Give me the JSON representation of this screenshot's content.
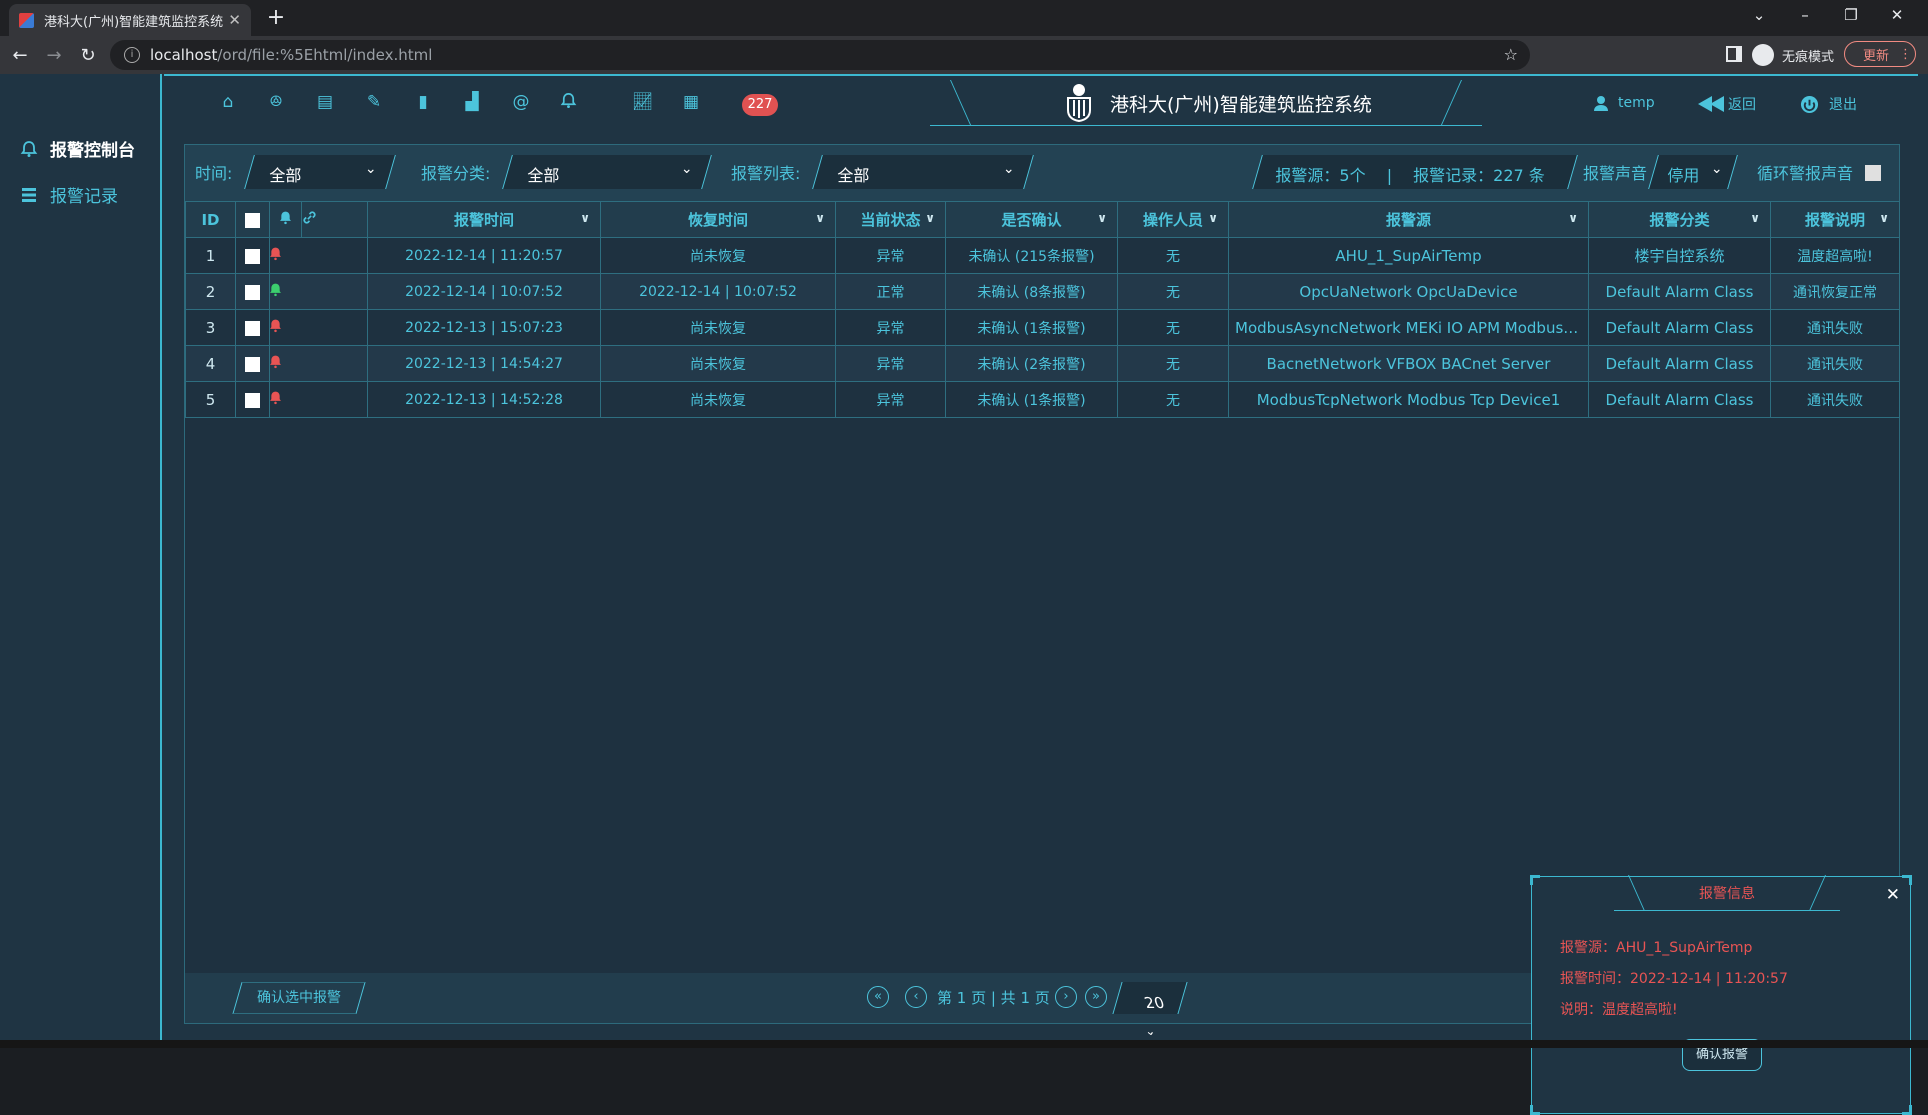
{
  "browser": {
    "tab_title": "港科大(广州)智能建筑监控系统",
    "url_host": "localhost",
    "url_path": "/ord/file:%5Ehtml/index.html",
    "incognito_label": "无痕模式",
    "update_label": "更新"
  },
  "sidebar": {
    "items": [
      {
        "label": "报警控制台",
        "icon": "bell-icon"
      },
      {
        "label": "报警记录",
        "icon": "list-icon"
      }
    ]
  },
  "topnav": {
    "icons": [
      "home-icon",
      "people-icon",
      "building-icon",
      "tool-icon",
      "device-icon",
      "bar-chart-icon",
      "clip-icon",
      "bell-icon",
      "line-chart-icon",
      "calendar-icon"
    ],
    "alarm_badge": "227",
    "title": "港科大(广州)智能建筑监控系统",
    "user": "temp",
    "back": "返回",
    "logout": "退出"
  },
  "filters": {
    "time_label": "时间:",
    "time_value": "全部",
    "category_label": "报警分类:",
    "category_value": "全部",
    "list_label": "报警列表:",
    "list_value": "全部",
    "counts": "报警源：5个  　|　  报警记录：227 条",
    "sound_label": "报警声音",
    "sound_value": "停用",
    "loop_label": "循环警报声音"
  },
  "table": {
    "headers": [
      "ID",
      "报警时间",
      "恢复时间",
      "当前状态",
      "是否确认",
      "操作人员",
      "报警源",
      "报警分类",
      "报警说明"
    ],
    "rows": [
      {
        "id": "1",
        "bell": "red",
        "time": "2022-12-14 | 11:20:57",
        "recover": "尚未恢复",
        "state": "异常",
        "ack": "未确认 (215条报警)",
        "op": "无",
        "source": "AHU_1_SupAirTemp",
        "cls": "楼宇自控系统",
        "desc": "温度超高啦!"
      },
      {
        "id": "2",
        "bell": "green",
        "time": "2022-12-14 | 10:07:52",
        "recover": "2022-12-14 | 10:07:52",
        "state": "正常",
        "ack": "未确认 (8条报警)",
        "op": "无",
        "source": "OpcUaNetwork OpcUaDevice",
        "cls": "Default Alarm Class",
        "desc": "通讯恢复正常"
      },
      {
        "id": "3",
        "bell": "red",
        "time": "2022-12-13 | 15:07:23",
        "recover": "尚未恢复",
        "state": "异常",
        "ack": "未确认 (1条报警)",
        "op": "无",
        "source": "ModbusAsyncNetwork MEKi IO APM Modbus As...",
        "cls": "Default Alarm Class",
        "desc": "通讯失败"
      },
      {
        "id": "4",
        "bell": "red",
        "time": "2022-12-13 | 14:54:27",
        "recover": "尚未恢复",
        "state": "异常",
        "ack": "未确认 (2条报警)",
        "op": "无",
        "source": "BacnetNetwork VFBOX BACnet Server",
        "cls": "Default Alarm Class",
        "desc": "通讯失败"
      },
      {
        "id": "5",
        "bell": "red",
        "time": "2022-12-13 | 14:52:28",
        "recover": "尚未恢复",
        "state": "异常",
        "ack": "未确认 (1条报警)",
        "op": "无",
        "source": "ModbusTcpNetwork Modbus Tcp Device1",
        "cls": "Default Alarm Class",
        "desc": "通讯失败"
      }
    ]
  },
  "footer": {
    "confirm_selected": "确认选中报警",
    "page_info": "第 1 页 | 共 1 页",
    "page_size": "20"
  },
  "popup": {
    "title": "报警信息",
    "source": "报警源：AHU_1_SupAirTemp",
    "time": "报警时间：2022-12-14 | 11:20:57",
    "desc": "说明：温度超高啦!",
    "confirm": "确认报警"
  },
  "colors": {
    "accent": "#4cc4dc",
    "alarm": "#e85454",
    "ok": "#3ccf6e",
    "bg": "#1f3443"
  }
}
